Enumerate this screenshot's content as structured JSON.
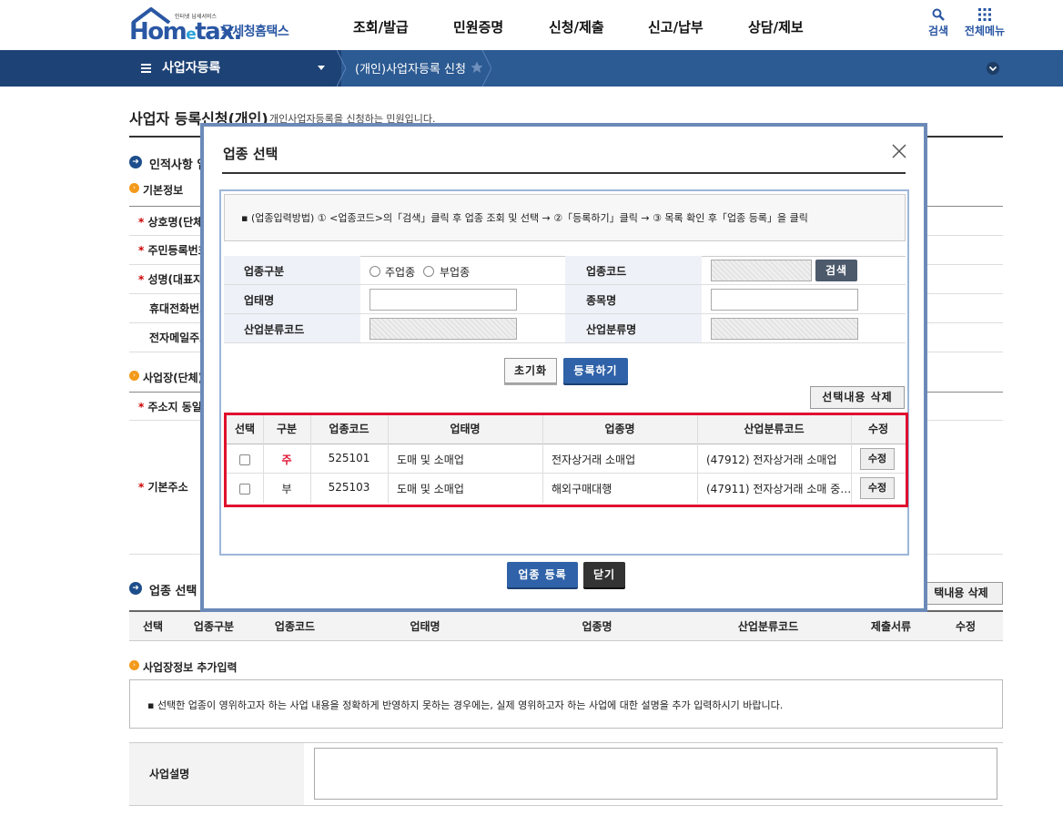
{
  "header": {
    "logo_tag": "인터넷 납세서비스",
    "logo_word_a": "Hom",
    "logo_word_b": "e",
    "logo_word_c": "tax.",
    "logo_kr": "국세청홈택스",
    "gnb": [
      "조회/발급",
      "민원증명",
      "신청/제출",
      "신고/납부",
      "상담/제보"
    ],
    "search_label": "검색",
    "allmenu_label": "전체메뉴"
  },
  "nav": {
    "menu_title": "사업자등록",
    "breadcrumb": "(개인)사업자등록 신청"
  },
  "page": {
    "title": "사업자 등록신청(개인)",
    "desc": "개인사업자등록을 신청하는 민원입니다.",
    "sec_personal": "인적사항 입",
    "sub_basic": "기본정보",
    "fields": [
      "상호명(단체",
      "주민등록번호",
      "성명(대표자",
      "휴대전화번호",
      "전자메일주소"
    ],
    "sub_site": "사업장(단체)",
    "addr_same": "주소지 동일",
    "base_addr": "기본주소",
    "sec_industry": "업종 선택",
    "del_selected": "택내용 삭제",
    "bottom_headers": [
      "선택",
      "업종구분",
      "업종코드",
      "업태명",
      "업종명",
      "산업분류코드",
      "제출서류",
      "수정"
    ],
    "sub_extra": "사업장정보 추가입력",
    "notice": "선택한 업종이 영위하고자 하는 사업 내용을 정확하게 반영하지 못하는 경우에는, 실제 영위하고자 하는 사업에 대한 설명을 추가 입력하시기 바랍니다.",
    "biz_desc": "사업설명"
  },
  "modal": {
    "title": "업종 선택",
    "guide": "(업종입력방법) ① <업종코드>의「검색」클릭 후 업종 조회 및 선택 → ②「등록하기」클릭 → ③ 목록 확인 후「업종 등록」을 클릭",
    "form": {
      "type_label": "업종구분",
      "radio_main": "주업종",
      "radio_sub": "부업종",
      "code_label": "업종코드",
      "search_btn": "검색",
      "biz_label": "업태명",
      "item_label": "종목명",
      "indcode_label": "산업분류코드",
      "indname_label": "산업분류명"
    },
    "reset_btn": "초기화",
    "register_btn": "등록하기",
    "delete_btn": "선택내용 삭제",
    "table_headers": [
      "선택",
      "구분",
      "업종코드",
      "업태명",
      "업종명",
      "산업분류코드",
      "수정"
    ],
    "rows": [
      {
        "kind": "주",
        "code": "525101",
        "biz": "도매 및 소매업",
        "item": "전자상거래 소매업",
        "ind": "(47912) 전자상거래 소매업",
        "edit": "수정"
      },
      {
        "kind": "부",
        "code": "525103",
        "biz": "도매 및 소매업",
        "item": "해외구매대행",
        "ind": "(47911) 전자상거래 소매 중…",
        "edit": "수정"
      }
    ],
    "submit_btn": "업종 등록",
    "close_btn": "닫기"
  },
  "colors": {
    "brand": "#2a57a3",
    "nav": "#2c5a92",
    "highlight": "#e0102e",
    "main_kind": "#e0102e"
  }
}
